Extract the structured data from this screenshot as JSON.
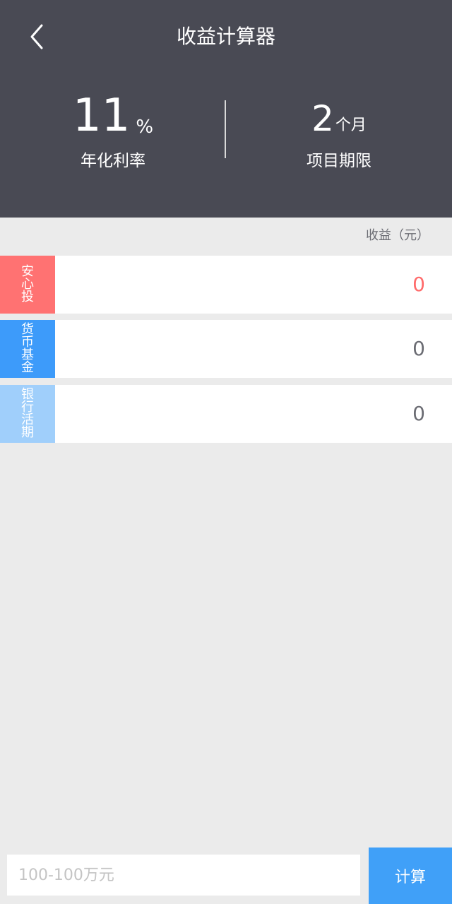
{
  "header": {
    "title": "收益计算器",
    "rate": {
      "value": "11",
      "unit": "%",
      "label": "年化利率"
    },
    "term": {
      "value": "2",
      "unit": "个月",
      "label": "项目期限"
    }
  },
  "table": {
    "column_label": "收益（元）",
    "rows": [
      {
        "tag_chars": [
          "安",
          "心",
          "投"
        ],
        "value": "0",
        "color": "#ff7272"
      },
      {
        "tag_chars": [
          "货",
          "币",
          "基",
          "金"
        ],
        "value": "0",
        "color": "#3d9bfa"
      },
      {
        "tag_chars": [
          "银",
          "行",
          "活",
          "期"
        ],
        "value": "0",
        "color": "#a0cffb"
      }
    ]
  },
  "footer": {
    "placeholder": "100-100万元",
    "button_label": "计算"
  },
  "colors": {
    "header_bg": "#494a54",
    "highlight": "#ff6b6b",
    "accent": "#40a0f8",
    "page_bg": "#ebebeb"
  }
}
